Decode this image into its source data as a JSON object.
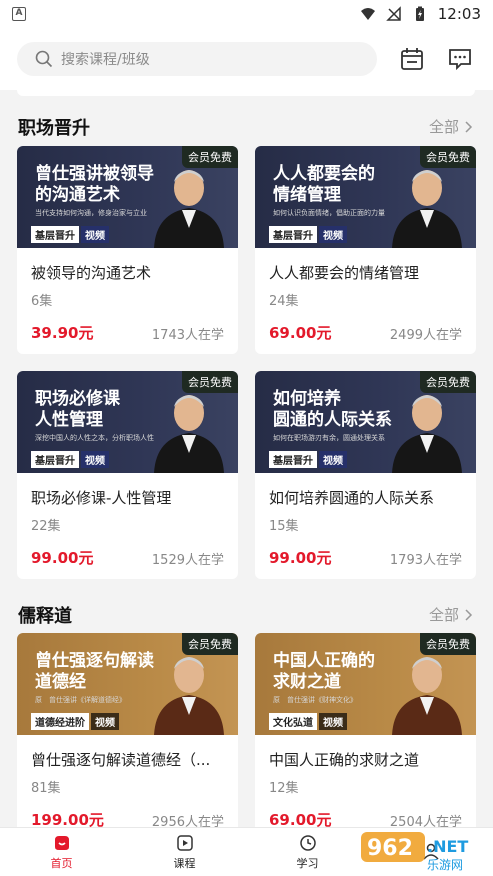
{
  "status": {
    "left_icon": "A",
    "time": "12:03"
  },
  "search": {
    "placeholder": "搜索课程/班级"
  },
  "sections": [
    {
      "title": "职场晋升",
      "all": "全部"
    },
    {
      "title": "儒释道",
      "all": "全部"
    }
  ],
  "cards": [
    {
      "badge": "会员免费",
      "thumb_line1": "曾仕强讲被领导",
      "thumb_line2": "的沟通艺术",
      "thumb_sub": "当代支持如何沟通，修身治家与立业",
      "tag1": "基层晋升",
      "tag2": "视频",
      "name": "被领导的沟通艺术",
      "count": "6集",
      "price": "39.90元",
      "learners": "1743人在学",
      "theme": "navy"
    },
    {
      "badge": "会员免费",
      "thumb_line1": "人人都要会的",
      "thumb_line2": "情绪管理",
      "thumb_sub": "如何认识负面情绪，倡助正面的力量",
      "tag1": "基层晋升",
      "tag2": "视频",
      "name": "人人都要会的情绪管理",
      "count": "24集",
      "price": "69.00元",
      "learners": "2499人在学",
      "theme": "navy"
    },
    {
      "badge": "会员免费",
      "thumb_line1": "职场必修课",
      "thumb_line2": "人性管理",
      "thumb_sub": "深挖中国人的人性之本，分析职场人性",
      "tag1": "基层晋升",
      "tag2": "视频",
      "name": "职场必修课-人性管理",
      "count": "22集",
      "price": "99.00元",
      "learners": "1529人在学",
      "theme": "navy"
    },
    {
      "badge": "会员免费",
      "thumb_line1": "如何培养",
      "thumb_line2": "圆通的人际关系",
      "thumb_sub": "如何在职场游刃有余，圆通处理关系",
      "tag1": "基层晋升",
      "tag2": "视频",
      "name": "如何培养圆通的人际关系",
      "count": "15集",
      "price": "99.00元",
      "learners": "1793人在学",
      "theme": "navy"
    },
    {
      "badge": "会员免费",
      "thumb_line1": "曾仕强逐句解读",
      "thumb_line2": "道德经",
      "thumb_sub": "原　曾仕强讲《详解道德经》",
      "tag1": "道德经进阶",
      "tag2": "视频",
      "name": "曾仕强逐句解读道德经（...",
      "count": "81集",
      "price": "199.00元",
      "learners": "2956人在学",
      "theme": "gold"
    },
    {
      "badge": "会员免费",
      "thumb_line1": "中国人正确的",
      "thumb_line2": "求财之道",
      "thumb_sub": "原　曾仕强讲《财神文化》",
      "tag1": "文化弘道",
      "tag2": "视频",
      "name": "中国人正确的求财之道",
      "count": "12集",
      "price": "69.00元",
      "learners": "2504人在学",
      "theme": "gold"
    }
  ],
  "tabbar": [
    {
      "label": "首页",
      "icon": "home-icon",
      "active": true
    },
    {
      "label": "课程",
      "icon": "play-icon",
      "active": false
    },
    {
      "label": "学习",
      "icon": "clock-icon",
      "active": false
    },
    {
      "label": "",
      "icon": "user-icon",
      "active": false
    }
  ],
  "watermark": {
    "text1": "962",
    "text2": ".NET",
    "text3": "乐游网"
  },
  "colors": {
    "accent": "#e3192b",
    "navy": "#2f3655",
    "gold": "#b98a47"
  }
}
